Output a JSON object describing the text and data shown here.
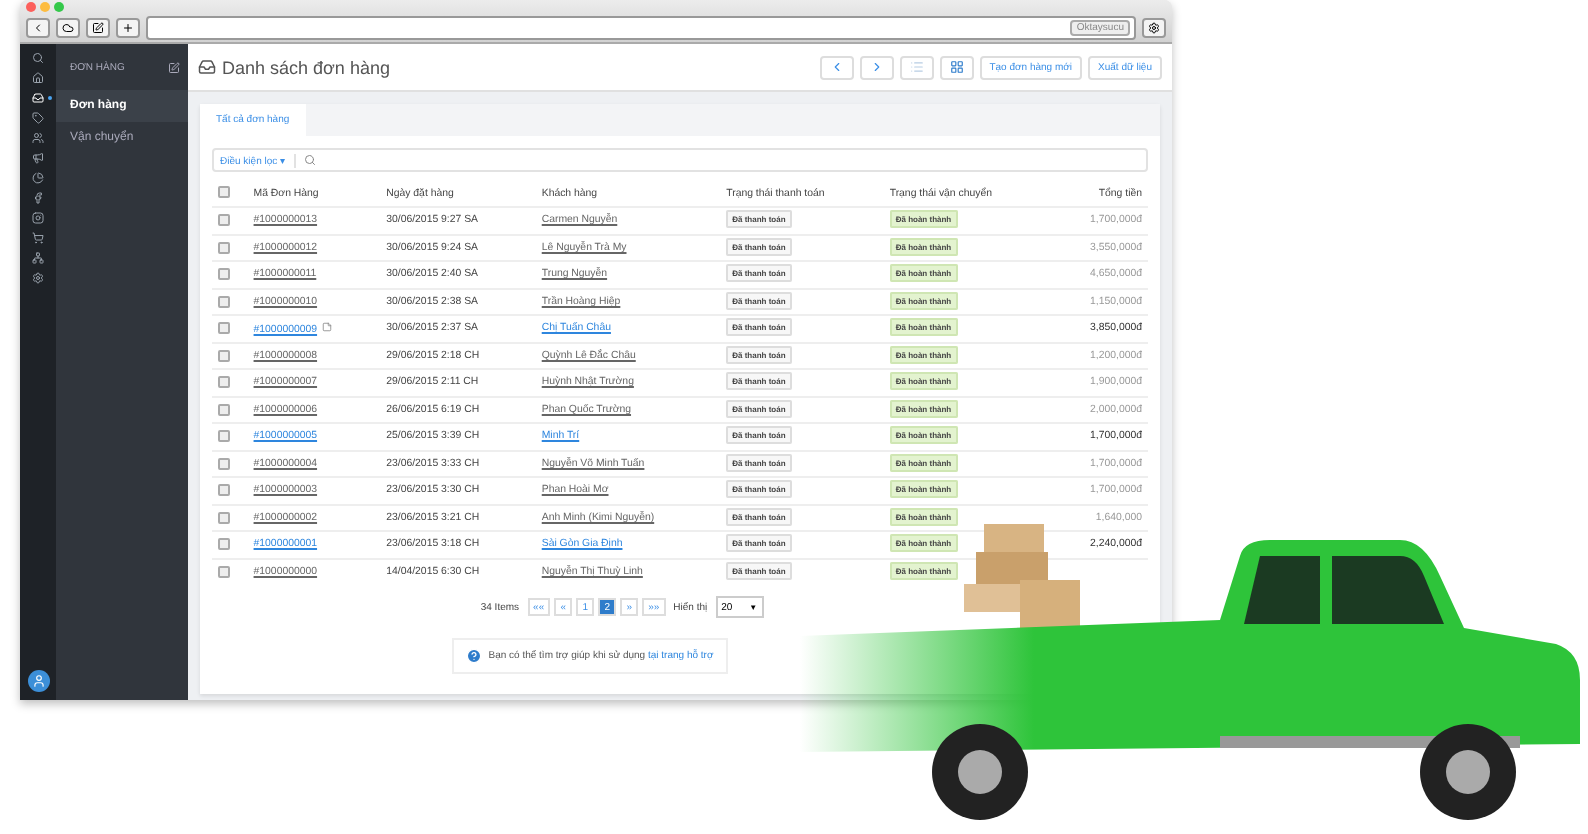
{
  "browser": {
    "search_text": "Oktaysucu"
  },
  "rail_items": [
    {
      "selected": false
    },
    {
      "selected": false
    },
    {
      "selected": true
    },
    {
      "selected": false
    },
    {
      "selected": false
    },
    {
      "selected": false
    },
    {
      "selected": false
    },
    {
      "selected": false
    },
    {
      "selected": false
    },
    {
      "selected": false
    },
    {
      "selected": false
    },
    {
      "selected": false
    }
  ],
  "sidebar": {
    "title": "ĐƠN HÀNG",
    "items": [
      {
        "label": "Đơn hàng",
        "selected": true
      },
      {
        "label": "Vận chuyển",
        "selected": false
      }
    ]
  },
  "header": {
    "title": "Danh sách đơn hàng",
    "view_modes": [
      {
        "kind": "list",
        "selected": false
      },
      {
        "kind": "grid",
        "selected": true
      }
    ],
    "buttons": [
      "Tạo đơn hàng mới",
      "Xuất dữ liệu"
    ]
  },
  "tabs": [
    {
      "label": "Tất cả đơn hàng",
      "selected": true
    }
  ],
  "filter": {
    "label": "Điều kiện lọc",
    "caret": "▾"
  },
  "table": {
    "select_all_checked": false,
    "columns": [
      "Mã Đơn Hàng",
      "Ngày đặt hàng",
      "Khách hàng",
      "Trạng thái thanh toán",
      "Trạng thái vận chuyển",
      "Tổng tiền"
    ],
    "rows": [
      {
        "checked": false,
        "highlighted": false,
        "has_note": false,
        "id": "#1000000013",
        "date": "30/06/2015 9:27 SA",
        "customer": "Carmen Nguyễn",
        "payment": "Đã thanh toán",
        "shipping": "Đã hoàn thành",
        "total": "1,700,000đ"
      },
      {
        "checked": false,
        "highlighted": false,
        "has_note": false,
        "id": "#1000000012",
        "date": "30/06/2015 9:24 SA",
        "customer": "Lê Nguyễn Trà My",
        "payment": "Đã thanh toán",
        "shipping": "Đã hoàn thành",
        "total": "3,550,000đ"
      },
      {
        "checked": false,
        "highlighted": false,
        "has_note": false,
        "id": "#1000000011",
        "date": "30/06/2015 2:40 SA",
        "customer": "Trung Nguyễn",
        "payment": "Đã thanh toán",
        "shipping": "Đã hoàn thành",
        "total": "4,650,000đ"
      },
      {
        "checked": false,
        "highlighted": false,
        "has_note": false,
        "id": "#1000000010",
        "date": "30/06/2015 2:38 SA",
        "customer": "Trần Hoàng Hiệp",
        "payment": "Đã thanh toán",
        "shipping": "Đã hoàn thành",
        "total": "1,150,000đ"
      },
      {
        "checked": false,
        "highlighted": true,
        "has_note": true,
        "id": "#1000000009",
        "date": "30/06/2015 2:37 SA",
        "customer": "Chị Tuấn Châu",
        "payment": "Đã thanh toán",
        "shipping": "Đã hoàn thành",
        "total": "3,850,000đ"
      },
      {
        "checked": false,
        "highlighted": false,
        "has_note": false,
        "id": "#1000000008",
        "date": "29/06/2015 2:18 CH",
        "customer": "Quỳnh Lê Đắc Châu",
        "payment": "Đã thanh toán",
        "shipping": "Đã hoàn thành",
        "total": "1,200,000đ"
      },
      {
        "checked": false,
        "highlighted": false,
        "has_note": false,
        "id": "#1000000007",
        "date": "29/06/2015 2:11 CH",
        "customer": "Huỳnh Nhật Trường",
        "payment": "Đã thanh toán",
        "shipping": "Đã hoàn thành",
        "total": "1,900,000đ"
      },
      {
        "checked": false,
        "highlighted": false,
        "has_note": false,
        "id": "#1000000006",
        "date": "26/06/2015 6:19 CH",
        "customer": "Phan Quốc Trường",
        "payment": "Đã thanh toán",
        "shipping": "Đã hoàn thành",
        "total": "2,000,000đ"
      },
      {
        "checked": false,
        "highlighted": true,
        "has_note": false,
        "id": "#1000000005",
        "date": "25/06/2015 3:39 CH",
        "customer": "Minh Trí",
        "payment": "Đã thanh toán",
        "shipping": "Đã hoàn thành",
        "total": "1,700,000đ"
      },
      {
        "checked": false,
        "highlighted": false,
        "has_note": false,
        "id": "#1000000004",
        "date": "23/06/2015 3:33 CH",
        "customer": "Nguyễn Võ Minh Tuấn",
        "payment": "Đã thanh toán",
        "shipping": "Đã hoàn thành",
        "total": "1,700,000đ"
      },
      {
        "checked": false,
        "highlighted": false,
        "has_note": false,
        "id": "#1000000003",
        "date": "23/06/2015 3:30 CH",
        "customer": "Phan Hoài Mơ",
        "payment": "Đã thanh toán",
        "shipping": "Đã hoàn thành",
        "total": "1,700,000đ"
      },
      {
        "checked": false,
        "highlighted": false,
        "has_note": false,
        "id": "#1000000002",
        "date": "23/06/2015 3:21 CH",
        "customer": "Anh Minh (Kimi Nguyễn)",
        "payment": "Đã thanh toán",
        "shipping": "Đã hoàn thành",
        "total": "1,640,000"
      },
      {
        "checked": false,
        "highlighted": true,
        "has_note": false,
        "id": "#1000000001",
        "date": "23/06/2015 3:18 CH",
        "customer": "Sài Gòn Gia Định",
        "payment": "Đã thanh toán",
        "shipping": "Đã hoàn thành",
        "total": "2,240,000đ"
      },
      {
        "checked": false,
        "highlighted": false,
        "has_note": false,
        "id": "#1000000000",
        "date": "14/04/2015 6:30 CH",
        "customer": "Nguyễn Thị Thuỳ Linh",
        "payment": "Đã thanh toán",
        "shipping": "Đã hoàn thành"
      }
    ]
  },
  "pagination": {
    "count": "34 Items",
    "first": "««",
    "prev": "«",
    "pages": [
      {
        "label": "1",
        "selected": false
      },
      {
        "label": "2",
        "selected": true
      }
    ],
    "next": "»",
    "last": "»»",
    "show_label": "Hiển thị",
    "page_size": "20",
    "select_caret": "▼"
  },
  "help": {
    "text": "Bạn có thể tìm trợ giúp khi sử dụng",
    "link": "tại trang hỗ trợ"
  }
}
